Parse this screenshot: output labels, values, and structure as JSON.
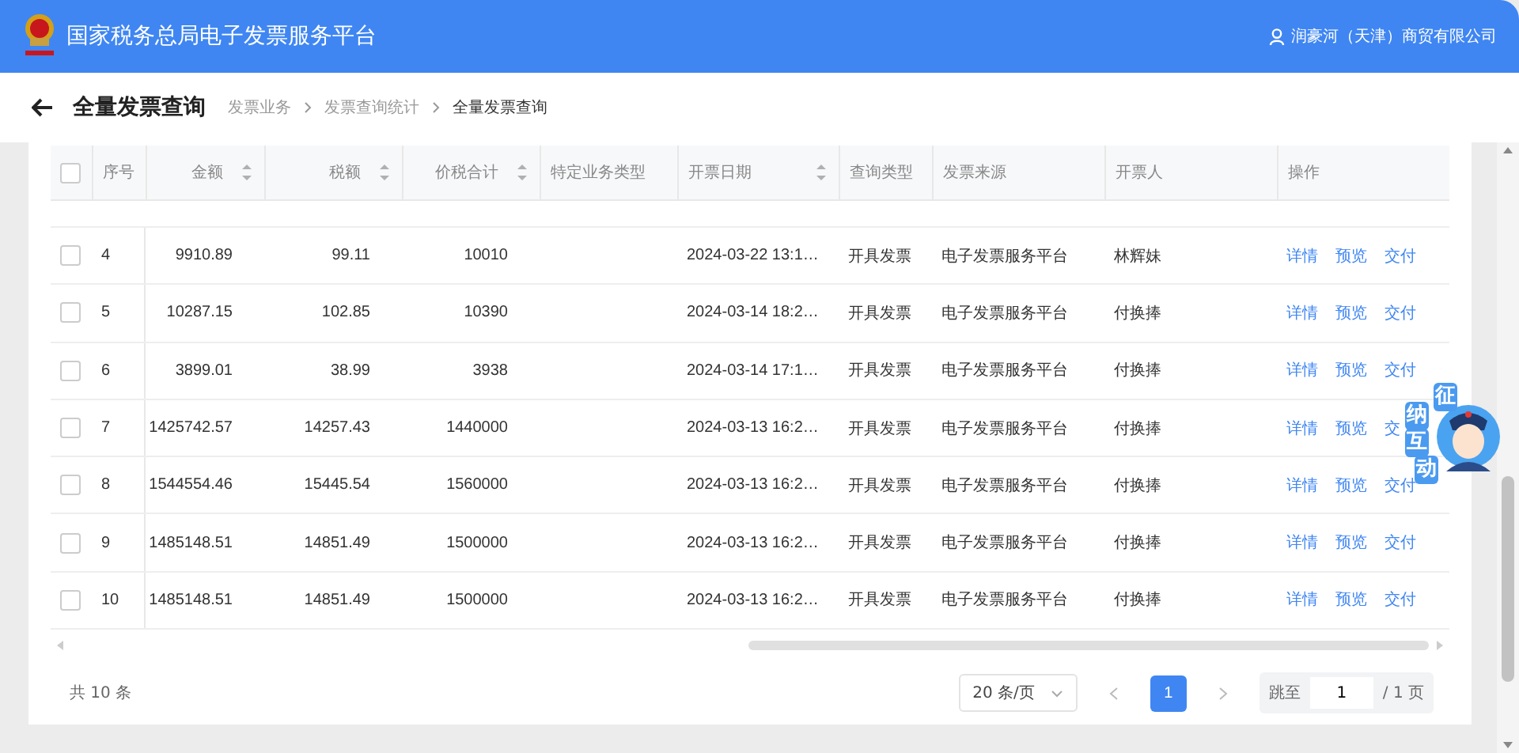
{
  "header": {
    "title": "国家税务总局电子发票服务平台",
    "user": "润豪河（天津）商贸有限公司"
  },
  "page": {
    "title": "全量发票查询",
    "breadcrumb": [
      {
        "label": "发票业务",
        "current": false
      },
      {
        "label": "发票查询统计",
        "current": false
      },
      {
        "label": "全量发票查询",
        "current": true
      }
    ]
  },
  "table": {
    "select_all": {
      "checked": false
    },
    "columns": [
      {
        "label": "序号",
        "sortable": false,
        "kind": "text"
      },
      {
        "label": "金额",
        "sortable": true,
        "kind": "number"
      },
      {
        "label": "税额",
        "sortable": true,
        "kind": "number"
      },
      {
        "label": "价税合计",
        "sortable": true,
        "kind": "number"
      },
      {
        "label": "特定业务类型",
        "sortable": false,
        "kind": "text"
      },
      {
        "label": "开票日期",
        "sortable": true,
        "kind": "text"
      },
      {
        "label": "查询类型",
        "sortable": false,
        "kind": "text"
      },
      {
        "label": "发票来源",
        "sortable": false,
        "kind": "text"
      },
      {
        "label": "开票人",
        "sortable": false,
        "kind": "text"
      },
      {
        "label": "操作",
        "sortable": false,
        "kind": "text"
      }
    ],
    "rows": [
      {
        "checked": false,
        "cells": [
          "4",
          "9910.89",
          "99.11",
          "10010",
          "",
          "2024-03-22 13:1…",
          "开具发票",
          "电子发票服务平台",
          "林辉妹"
        ],
        "actions": [
          "详情",
          "预览",
          "交付"
        ]
      },
      {
        "checked": false,
        "cells": [
          "5",
          "10287.15",
          "102.85",
          "10390",
          "",
          "2024-03-14 18:2…",
          "开具发票",
          "电子发票服务平台",
          "付换捧"
        ],
        "actions": [
          "详情",
          "预览",
          "交付"
        ]
      },
      {
        "checked": false,
        "cells": [
          "6",
          "3899.01",
          "38.99",
          "3938",
          "",
          "2024-03-14 17:1…",
          "开具发票",
          "电子发票服务平台",
          "付换捧"
        ],
        "actions": [
          "详情",
          "预览",
          "交付"
        ]
      },
      {
        "checked": false,
        "cells": [
          "7",
          "1425742.57",
          "14257.43",
          "1440000",
          "",
          "2024-03-13 16:2…",
          "开具发票",
          "电子发票服务平台",
          "付换捧"
        ],
        "actions": [
          "详情",
          "预览",
          "交"
        ]
      },
      {
        "checked": false,
        "cells": [
          "8",
          "1544554.46",
          "15445.54",
          "1560000",
          "",
          "2024-03-13 16:2…",
          "开具发票",
          "电子发票服务平台",
          "付换捧"
        ],
        "actions": [
          "详情",
          "预览",
          "交付"
        ]
      },
      {
        "checked": false,
        "cells": [
          "9",
          "1485148.51",
          "14851.49",
          "1500000",
          "",
          "2024-03-13 16:2…",
          "开具发票",
          "电子发票服务平台",
          "付换捧"
        ],
        "actions": [
          "详情",
          "预览",
          "交付"
        ]
      },
      {
        "checked": false,
        "cells": [
          "10",
          "1485148.51",
          "14851.49",
          "1500000",
          "",
          "2024-03-13 16:2…",
          "开具发票",
          "电子发票服务平台",
          "付换捧"
        ],
        "actions": [
          "详情",
          "预览",
          "交付"
        ]
      }
    ]
  },
  "pagination": {
    "total": "共 10 条",
    "page_size": "20 条/页",
    "pages": [
      {
        "label": "1",
        "selected": true
      }
    ],
    "jump_label": "跳至",
    "jump_value": "1",
    "page_count": "/ 1 页"
  },
  "assistant": {
    "chars": [
      "征",
      "纳",
      "互",
      "动"
    ]
  }
}
